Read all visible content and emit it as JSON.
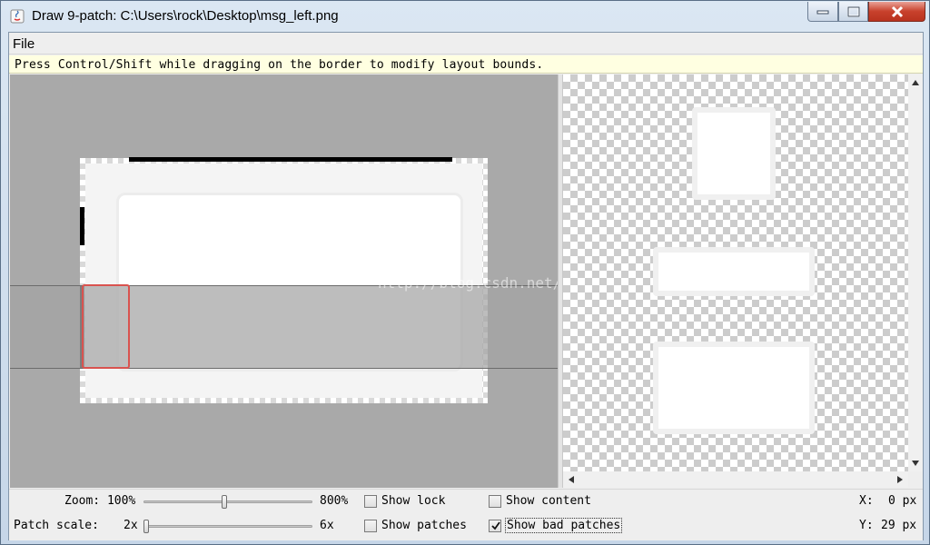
{
  "window": {
    "title": "Draw 9-patch: C:\\Users\\rock\\Desktop\\msg_left.png",
    "icon": "java-icon"
  },
  "menu": {
    "file_label": "File"
  },
  "hint": "Press Control/Shift while dragging on the border to modify layout bounds.",
  "editor": {
    "watermark": "http://blog.csdn.net/"
  },
  "controls": {
    "zoom_label": "Zoom: 100%",
    "zoom_max": "800%",
    "zoom_level": 0.48,
    "patch_scale_label": "Patch scale:",
    "patch_scale_min": "2x",
    "patch_scale_max": "6x",
    "patch_scale_level": 0.0,
    "show_lock": {
      "label": "Show lock",
      "checked": false
    },
    "show_patches": {
      "label": "Show patches",
      "checked": false
    },
    "show_content": {
      "label": "Show content",
      "checked": false
    },
    "show_bad_patches": {
      "label": "Show bad patches",
      "checked": true
    },
    "x_label": "X:",
    "x_value": "0 px",
    "y_label": "Y:",
    "y_value": "29 px"
  },
  "colors": {
    "bad_patch_outline": "#d9534f",
    "hint_background": "#ffffe1",
    "editor_background": "#a9a9a9"
  }
}
